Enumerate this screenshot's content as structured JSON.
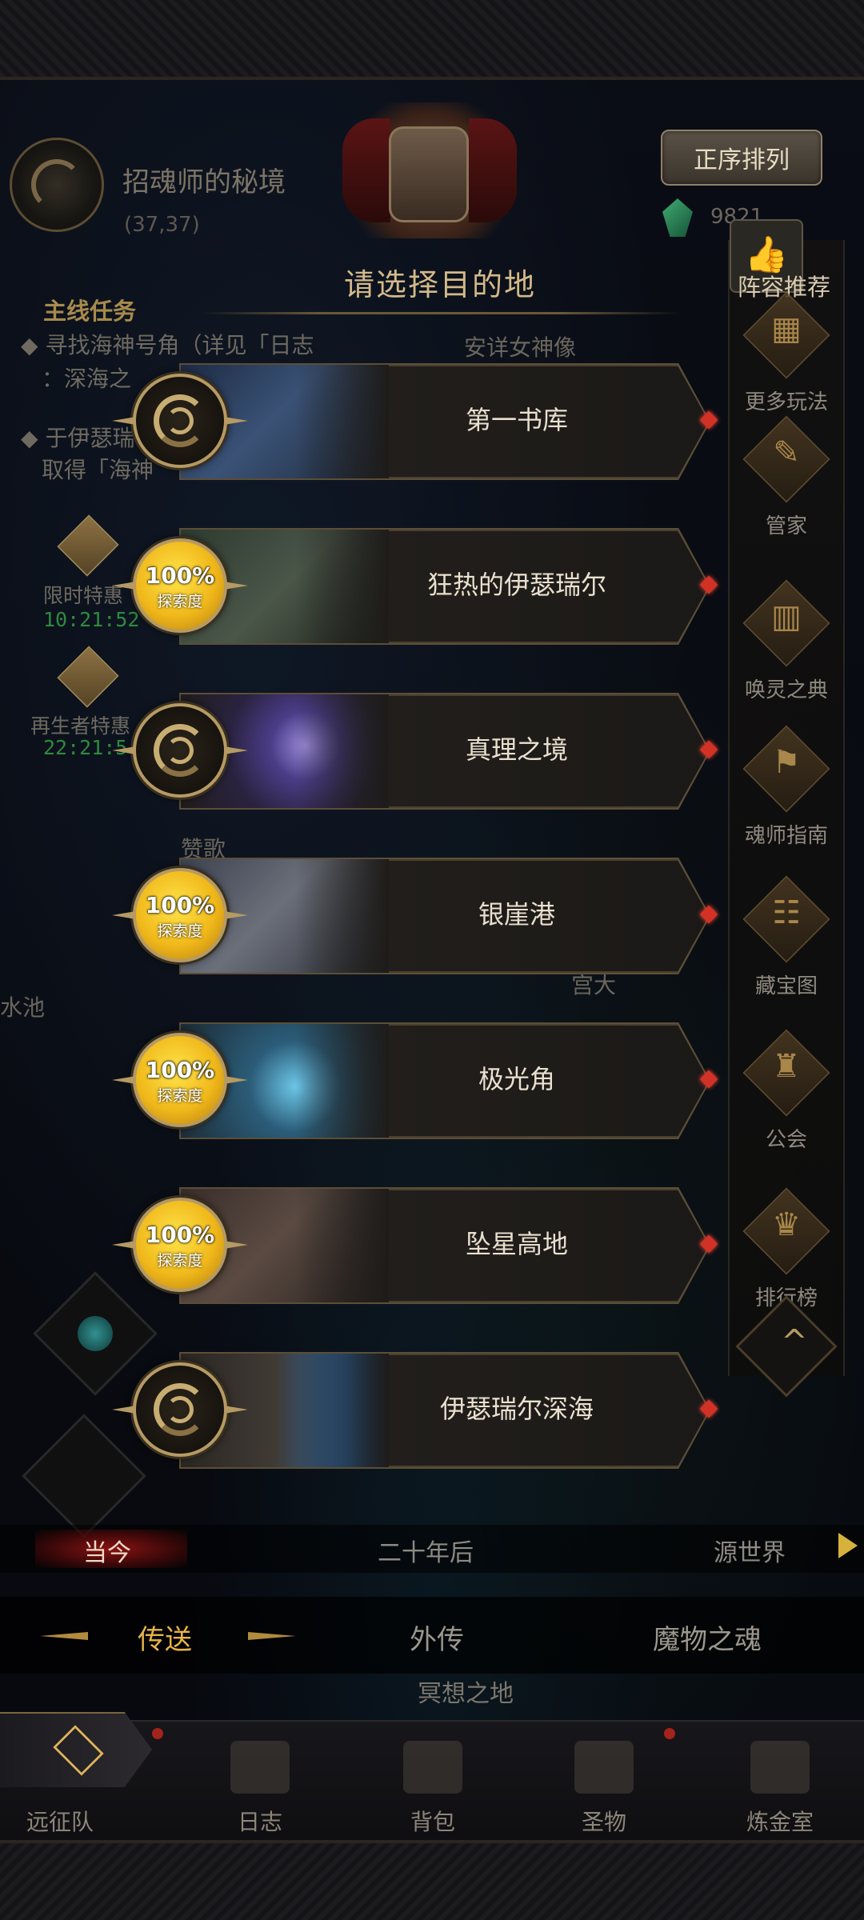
{
  "location": {
    "name": "招魂师的秘境",
    "coords": "(37,37)"
  },
  "header": {
    "sort_label": "正序排列",
    "gem_count": "9821"
  },
  "panel": {
    "title": "请选择目的地",
    "subtitle_text": "安详女神像"
  },
  "quest": {
    "heading": "主线任务",
    "line1": "寻找海神号角（详见「日志",
    "line2": "：深海之",
    "line3": "于伊瑟瑞",
    "line4": "取得「海神"
  },
  "promos": [
    {
      "label": "限时特惠",
      "timer": "10:21:52"
    },
    {
      "label": "再生者特惠",
      "timer": "22:21:5"
    }
  ],
  "background_texts": {
    "t1": "赞歌",
    "t2": "水池",
    "t3": "宫大",
    "t4": "冥想之地"
  },
  "sidebar": [
    {
      "label": "阵容推荐",
      "icon": "thumbs-up-icon"
    },
    {
      "label": "更多玩法",
      "icon": "gift-icon"
    },
    {
      "label": "管家",
      "icon": "quill-icon"
    },
    {
      "label": "唤灵之典",
      "icon": "book-icon"
    },
    {
      "label": "魂师指南",
      "icon": "guide-icon"
    },
    {
      "label": "藏宝图",
      "icon": "scroll-icon"
    },
    {
      "label": "公会",
      "icon": "guild-icon"
    },
    {
      "label": "排行榜",
      "icon": "trophy-icon"
    }
  ],
  "destinations": [
    {
      "name": "第一书库",
      "explored": false,
      "progress": "",
      "progress_label": "",
      "art": "library"
    },
    {
      "name": "狂热的伊瑟瑞尔",
      "explored": true,
      "progress": "100%",
      "progress_label": "探索度",
      "art": "statue"
    },
    {
      "name": "真理之境",
      "explored": false,
      "progress": "",
      "progress_label": "",
      "art": "portal"
    },
    {
      "name": "银崖港",
      "explored": true,
      "progress": "100%",
      "progress_label": "探索度",
      "art": "castle"
    },
    {
      "name": "极光角",
      "explored": true,
      "progress": "100%",
      "progress_label": "探索度",
      "art": "shrine"
    },
    {
      "name": "坠星高地",
      "explored": true,
      "progress": "100%",
      "progress_label": "探索度",
      "art": "ruins"
    },
    {
      "name": "伊瑟瑞尔深海",
      "explored": false,
      "progress": "",
      "progress_label": "",
      "art": "sea"
    }
  ],
  "eras": {
    "current": "当今",
    "future": "二十年后",
    "origin": "源世界"
  },
  "modes": {
    "teleport": "传送",
    "side_story": "外传",
    "monster_soul": "魔物之魂"
  },
  "nav": {
    "expedition": "远征队",
    "journal": "日志",
    "bag": "背包",
    "relic": "圣物",
    "alchemy": "炼金室"
  },
  "colors": {
    "accent_gold": "#b59a63",
    "title_gold": "#d3b98a",
    "active_tab": "#e8b44a",
    "badge_yellow": "#f0b81a",
    "red_gem": "#d23226"
  }
}
